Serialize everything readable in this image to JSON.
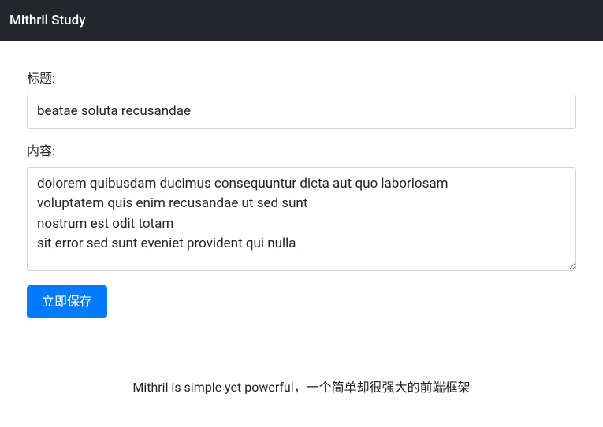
{
  "header": {
    "brand": "Mithril Study"
  },
  "form": {
    "title_label": "标题:",
    "title_value": "beatae soluta recusandae",
    "content_label": "内容:",
    "content_value": "dolorem quibusdam ducimus consequuntur dicta aut quo laboriosam\nvoluptatem quis enim recusandae ut sed sunt\nnostrum est odit totam\nsit error sed sunt eveniet provident qui nulla",
    "save_button": "立即保存"
  },
  "footer": {
    "text": "Mithril is simple yet powerful，一个简单却很强大的前端框架"
  }
}
